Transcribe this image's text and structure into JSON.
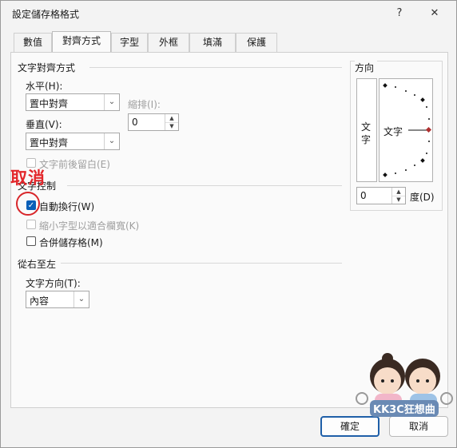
{
  "window": {
    "title": "設定儲存格格式",
    "help_glyph": "?",
    "close_glyph": "✕"
  },
  "tabs": [
    "數值",
    "對齊方式",
    "字型",
    "外框",
    "填滿",
    "保護"
  ],
  "active_tab": "對齊方式",
  "text_alignment": {
    "section_title": "文字對齊方式",
    "horizontal_label": "水平(H):",
    "horizontal_value": "置中對齊",
    "vertical_label": "垂直(V):",
    "vertical_value": "置中對齊",
    "indent_label": "縮排(I):",
    "indent_value": "0",
    "justify_distributed_label": "文字前後留白(E)"
  },
  "text_control": {
    "section_title": "文字控制",
    "wrap_text_label": "自動換行(W)",
    "wrap_text_checked": true,
    "shrink_to_fit_label": "縮小字型以適合欄寬(K)",
    "shrink_to_fit_checked": false,
    "merge_cells_label": "合併儲存格(M)",
    "merge_cells_checked": false
  },
  "rtl": {
    "section_title": "從右至左",
    "direction_label": "文字方向(T):",
    "direction_value": "內容"
  },
  "orientation": {
    "section_title": "方向",
    "vertical_text": "文字",
    "horizontal_text": "文字",
    "degrees_value": "0",
    "degrees_label": "度(D)"
  },
  "buttons": {
    "ok": "確定",
    "cancel": "取消"
  },
  "annotation": {
    "cancel_callout": "取消"
  },
  "watermark": {
    "text": "KK3C狂想曲"
  },
  "colors": {
    "accent": "#1f5fa8",
    "annotation_red": "#e3262a",
    "checkbox_blue": "#0a5fb8"
  }
}
